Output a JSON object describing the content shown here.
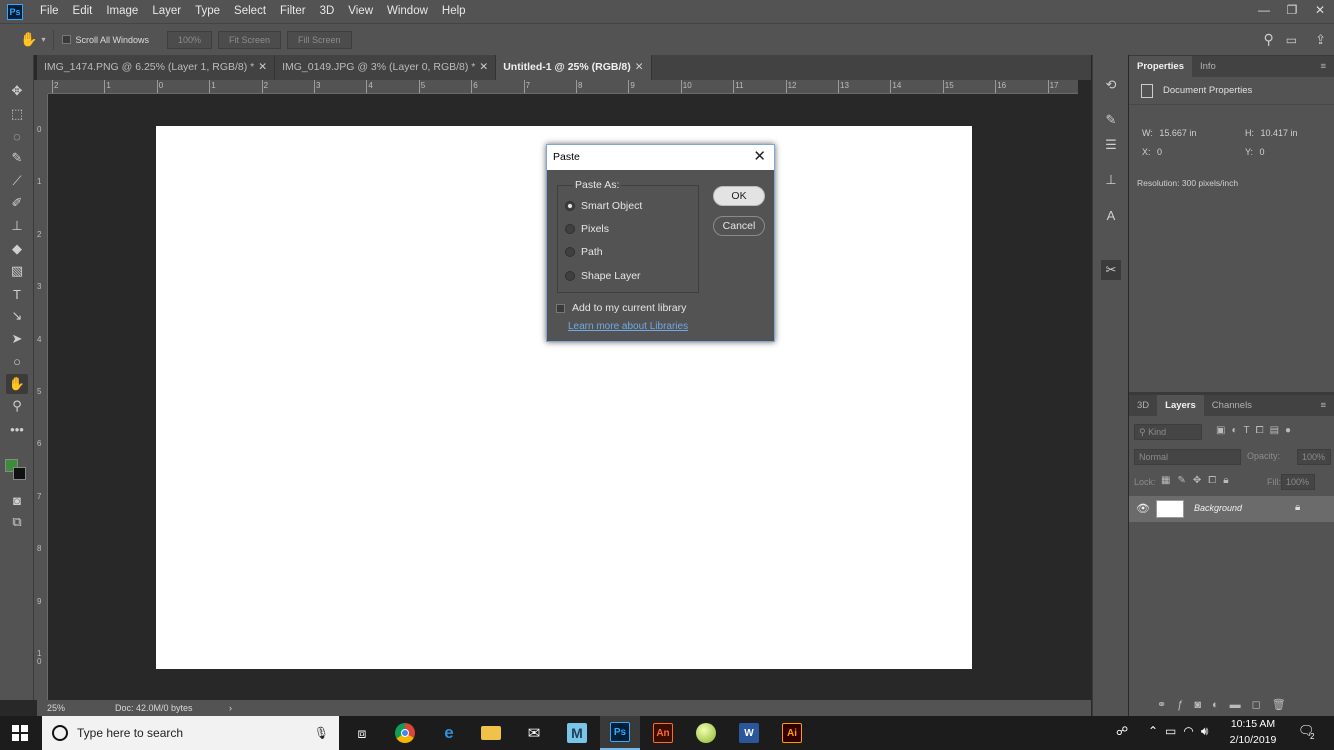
{
  "app": {
    "logo": "Ps"
  },
  "menu": [
    "File",
    "Edit",
    "Image",
    "Layer",
    "Type",
    "Select",
    "Filter",
    "3D",
    "View",
    "Window",
    "Help"
  ],
  "options": {
    "scroll_all_windows": "Scroll All Windows",
    "zoom_100": "100%",
    "fit_screen": "Fit Screen",
    "fill_screen": "Fill Screen"
  },
  "tabs": [
    {
      "label": "IMG_1474.PNG @ 6.25% (Layer 1, RGB/8) *",
      "active": false
    },
    {
      "label": "IMG_0149.JPG @ 3% (Layer 0, RGB/8) *",
      "active": false
    },
    {
      "label": "Untitled-1 @ 25% (RGB/8)",
      "active": true
    }
  ],
  "ruler_h": [
    "2",
    "1",
    "0",
    "1",
    "2",
    "3",
    "4",
    "5",
    "6",
    "7",
    "8",
    "9",
    "10",
    "11",
    "12",
    "13",
    "14",
    "15",
    "16",
    "17"
  ],
  "ruler_v": [
    "0",
    "1",
    "2",
    "3",
    "4",
    "5",
    "6",
    "7",
    "8",
    "9",
    "1\n0"
  ],
  "status": {
    "zoom": "25%",
    "doc": "Doc: 42.0M/0 bytes",
    "arrow": "›"
  },
  "colors": {
    "foreground": "#3c8c3c",
    "background": "#111111",
    "accent_link": "#6fa9e8"
  },
  "properties": {
    "tabs": [
      "Properties",
      "Info"
    ],
    "header": "Document Properties",
    "w_label": "W:",
    "w_value": "15.667 in",
    "h_label": "H:",
    "h_value": "10.417 in",
    "x_label": "X:",
    "x_value": "0",
    "y_label": "Y:",
    "y_value": "0",
    "resolution": "Resolution: 300 pixels/inch"
  },
  "layers": {
    "tabs": [
      "3D",
      "Layers",
      "Channels"
    ],
    "kind_placeholder": "Kind",
    "blend_mode": "Normal",
    "opacity_label": "Opacity:",
    "opacity_value": "100%",
    "lock_label": "Lock:",
    "fill_label": "Fill:",
    "fill_value": "100%",
    "layer_name": "Background"
  },
  "dialog": {
    "title": "Paste",
    "group_label": "Paste As:",
    "options": [
      {
        "label": "Smart Object",
        "selected": true
      },
      {
        "label": "Pixels",
        "selected": false
      },
      {
        "label": "Path",
        "selected": false
      },
      {
        "label": "Shape Layer",
        "selected": false
      }
    ],
    "ok": "OK",
    "cancel": "Cancel",
    "library_checkbox": "Add to my current library",
    "library_link": "Learn more about Libraries"
  },
  "taskbar": {
    "search_placeholder": "Type here to search",
    "time": "10:15 AM",
    "date": "2/10/2019",
    "notifications": "2",
    "apps": [
      "chrome",
      "edge",
      "file-explorer",
      "mail",
      "moviemaker",
      "photoshop",
      "animate",
      "app-ball",
      "word",
      "illustrator"
    ]
  }
}
